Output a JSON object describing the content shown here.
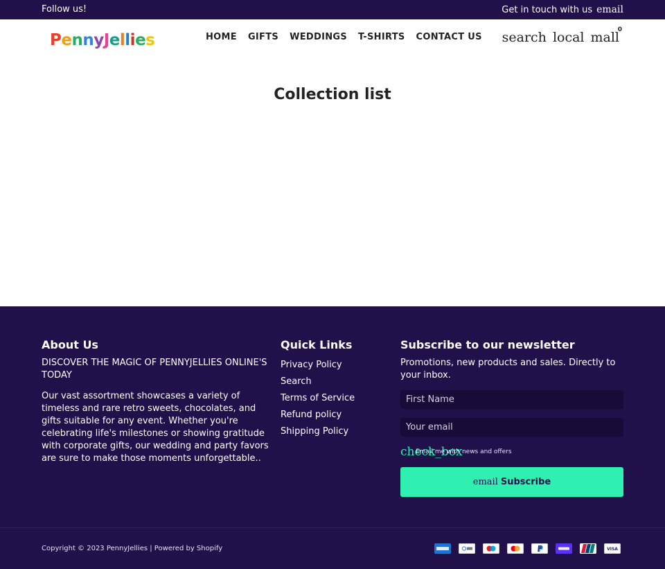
{
  "announcement": {
    "follow": "Follow us!",
    "contact": "Get in touch with us",
    "contact_icon": "email"
  },
  "logo": {
    "text": "PennyJellies"
  },
  "nav": {
    "items": [
      {
        "label": "HOME"
      },
      {
        "label": "GIFTS"
      },
      {
        "label": "WEDDINGS"
      },
      {
        "label": "T-SHIRTS"
      },
      {
        "label": "CONTACT US"
      }
    ]
  },
  "header_icons": {
    "search": "search",
    "account": "local",
    "cart": "mall",
    "cart_count": "0"
  },
  "main": {
    "title": "Collection list"
  },
  "footer": {
    "about": {
      "heading": "About Us",
      "intro": "DISCOVER THE MAGIC OF PENNYJELLIES ONLINE'S TODAY",
      "body": "Our vast assortment showcases a variety of timeless and rare retro sweets, chocolates, and gifts suitable for any event. Whether you're celebrating life's milestones or showing gratitude with corporate gifts, our wedding and party favors are sure to make those moments unforgettable.."
    },
    "quick_links": {
      "heading": "Quick Links",
      "items": [
        {
          "label": "Privacy Policy"
        },
        {
          "label": "Search"
        },
        {
          "label": "Terms of Service"
        },
        {
          "label": "Refund policy"
        },
        {
          "label": "Shipping Policy"
        }
      ]
    },
    "newsletter": {
      "heading": "Subscribe to our newsletter",
      "text": "Promotions, new products and sales. Directly to your inbox.",
      "first_name_placeholder": "First Name",
      "email_placeholder": "Your email",
      "checkbox_icon": "check_box",
      "checkbox_label": "Email me with news and offers",
      "button_icon": "email",
      "button_label": "Subscribe"
    },
    "copyright": "Copyright © 2023 PennyJellies | Powered by Shopify",
    "payment_methods": [
      "American Express",
      "Google Pay",
      "Maestro",
      "Mastercard",
      "PayPal",
      "Shop Pay",
      "Union Pay",
      "Visa"
    ]
  },
  "colors": {
    "brand_dark": "#21104a",
    "accent": "#2ff0b0"
  }
}
